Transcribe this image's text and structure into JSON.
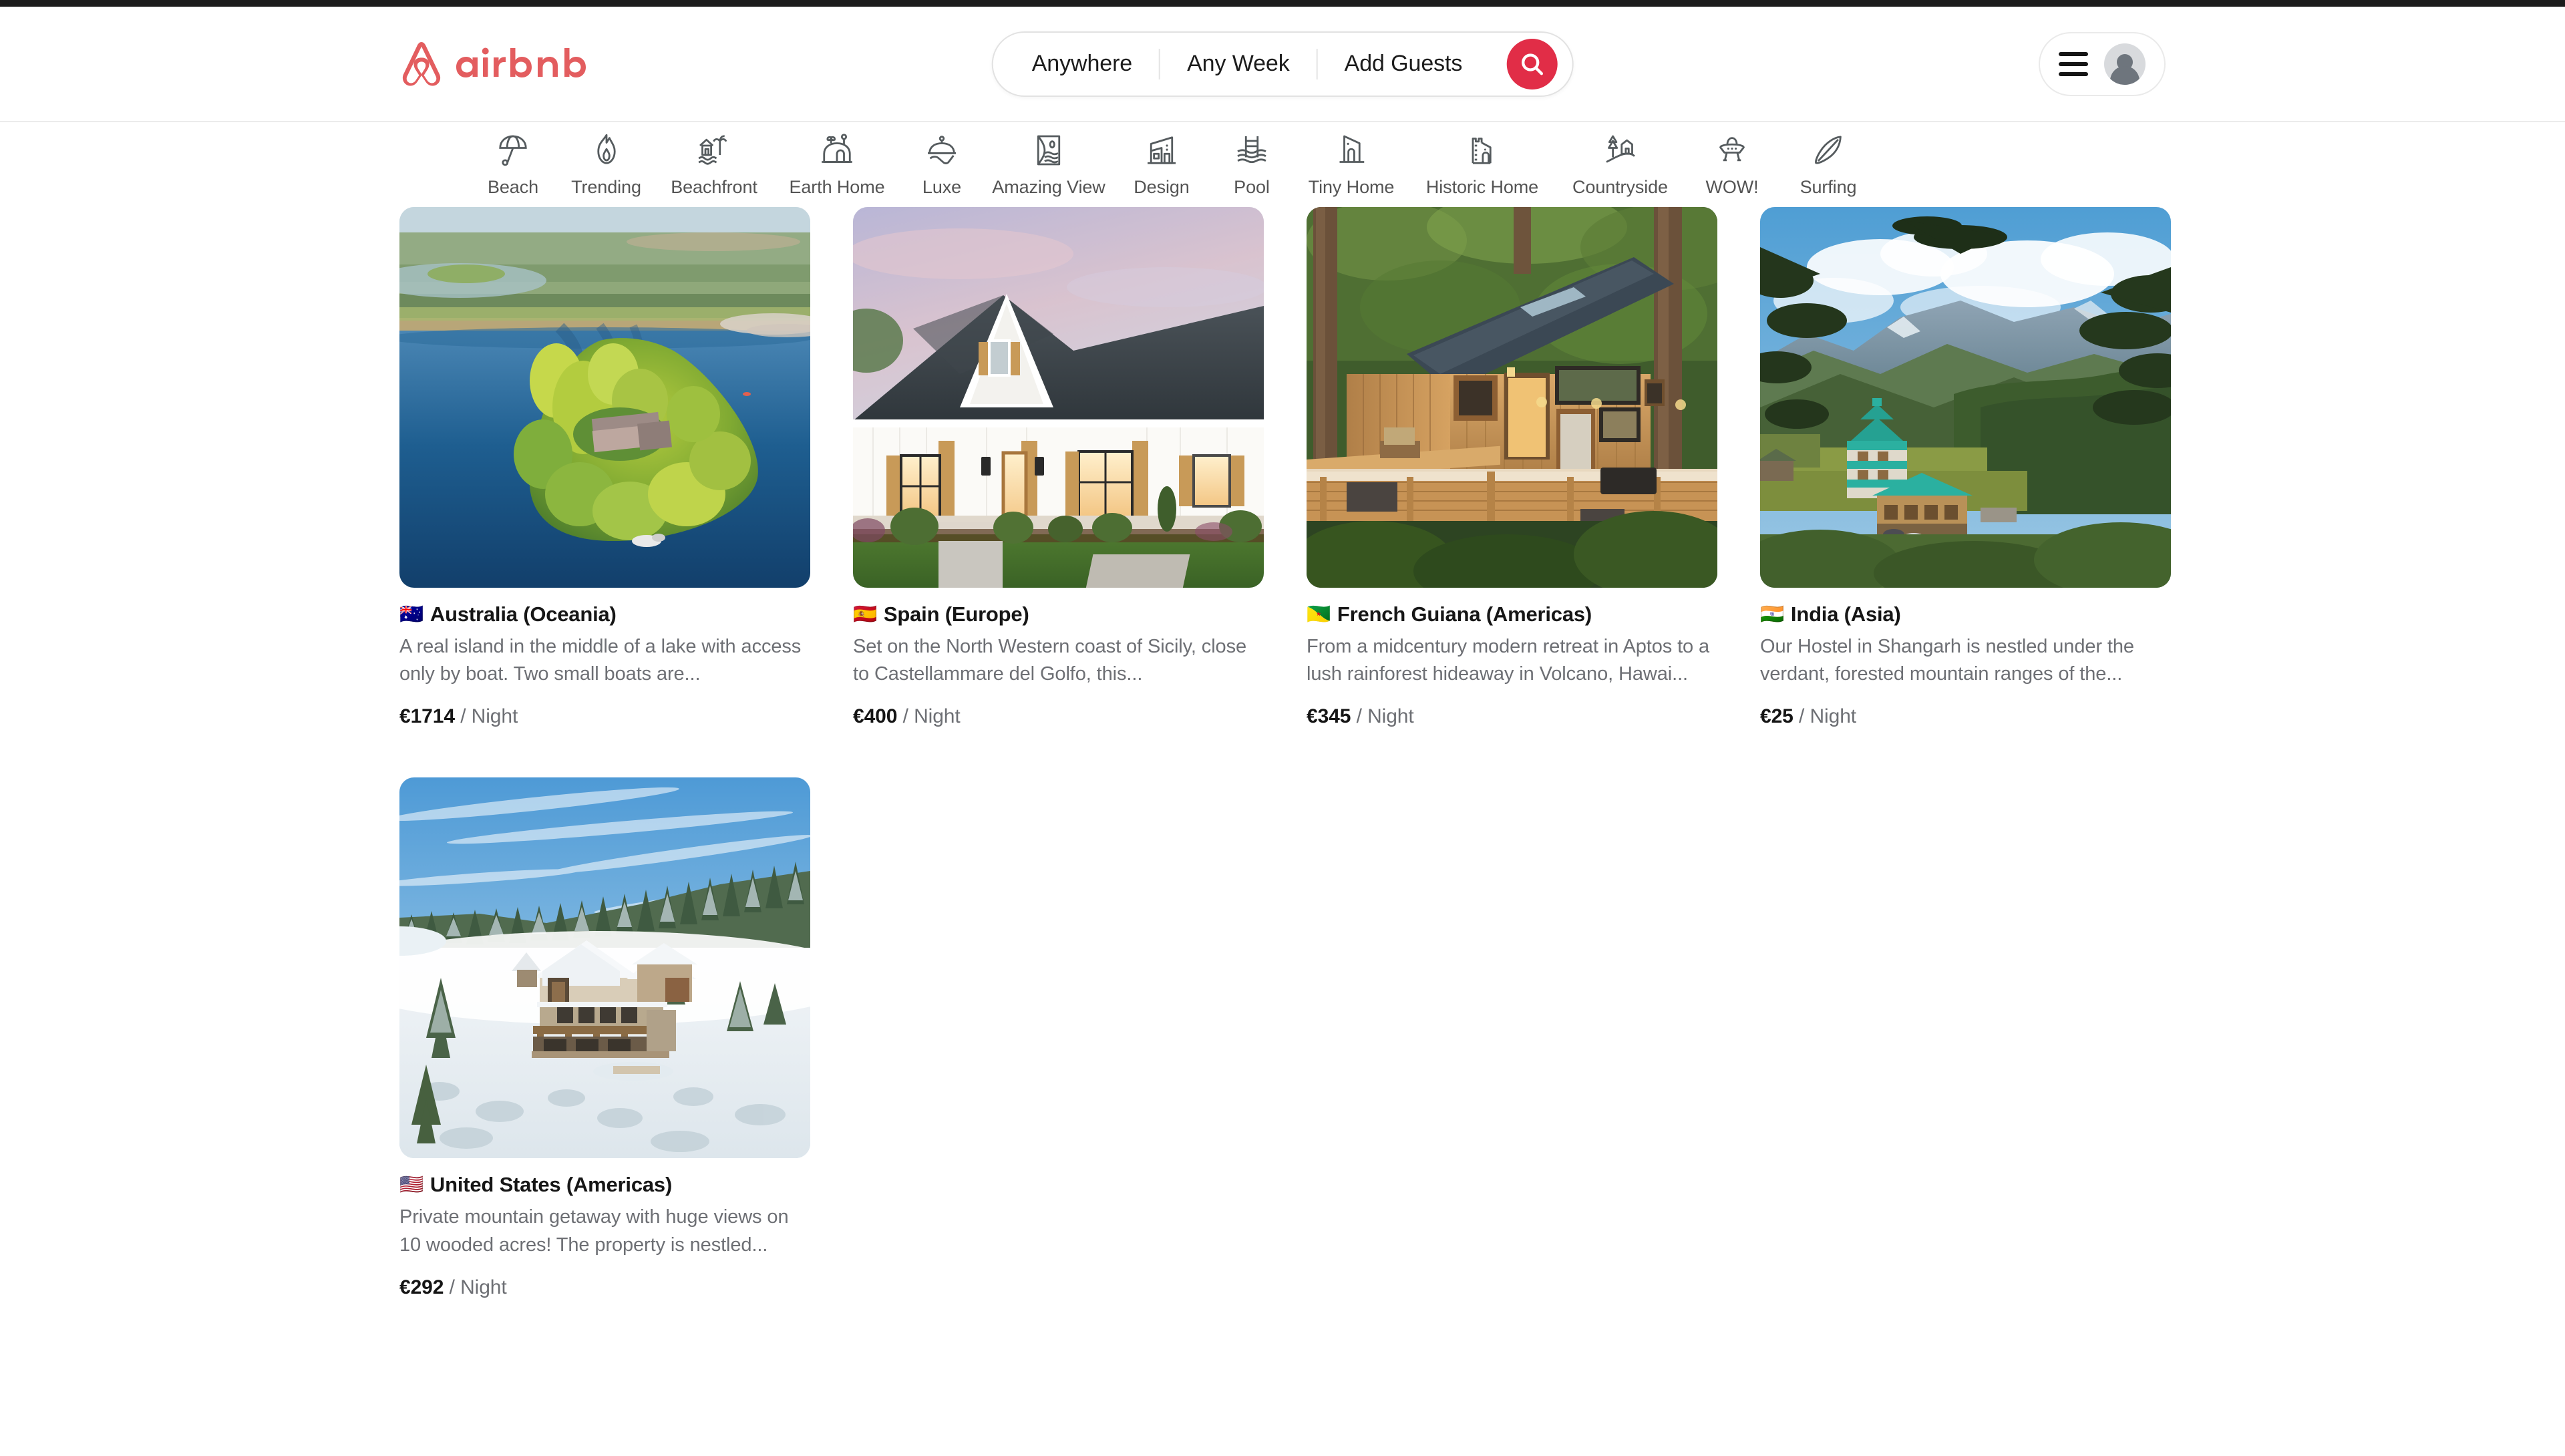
{
  "brand": {
    "name": "airbnb",
    "accent_color": "#e35d5f",
    "search_button_color": "#e12d47"
  },
  "header": {
    "search": {
      "location_label": "Anywhere",
      "dates_label": "Any Week",
      "guests_label": "Add Guests",
      "search_icon": "search-icon"
    },
    "user_menu": {
      "menu_icon": "hamburger-menu-icon",
      "avatar_icon": "user-avatar-icon"
    }
  },
  "categories": [
    {
      "label": "Beach",
      "icon": "beach-umbrella-icon"
    },
    {
      "label": "Trending",
      "icon": "flame-icon"
    },
    {
      "label": "Beachfront",
      "icon": "beachfront-hut-icon"
    },
    {
      "label": "Earth Home",
      "icon": "earth-home-icon"
    },
    {
      "label": "Luxe",
      "icon": "luxe-cloche-icon"
    },
    {
      "label": "Amazing View",
      "icon": "amazing-view-icon"
    },
    {
      "label": "Design",
      "icon": "design-building-icon"
    },
    {
      "label": "Pool",
      "icon": "pool-ladder-icon"
    },
    {
      "label": "Tiny Home",
      "icon": "tiny-home-icon"
    },
    {
      "label": "Historic Home",
      "icon": "castle-icon"
    },
    {
      "label": "Countryside",
      "icon": "countryside-icon"
    },
    {
      "label": "WOW!",
      "icon": "ufo-icon"
    },
    {
      "label": "Surfing",
      "icon": "surfboard-icon"
    }
  ],
  "listings": [
    {
      "flag": "🇦🇺",
      "title": "Australia (Oceania)",
      "description": "A real island in the middle of a lake with access only by boat. Two small boats are...",
      "price": "€1714",
      "price_unit": "/ Night",
      "image_alt": "aerial-view-island-on-lake"
    },
    {
      "flag": "🇪🇸",
      "title": "Spain (Europe)",
      "description": "Set on the North Western coast of Sicily, close to Castellammare del Golfo, this...",
      "price": "€400",
      "price_unit": "/ Night",
      "image_alt": "white-modern-farmhouse-at-dusk"
    },
    {
      "flag": "🇬🇫",
      "title": "French Guiana (Americas)",
      "description": "From a midcentury modern retreat in Aptos to a lush rainforest hideaway in Volcano, Hawai...",
      "price": "€345",
      "price_unit": "/ Night",
      "image_alt": "wooden-cabin-deck-in-forest"
    },
    {
      "flag": "🇮🇳",
      "title": "India (Asia)",
      "description": "Our Hostel in Shangarh is nestled under the verdant, forested mountain ranges of the...",
      "price": "€25",
      "price_unit": "/ Night",
      "image_alt": "himalayan-hostel-teal-roof-mountains"
    },
    {
      "flag": "🇺🇸",
      "title": "United States (Americas)",
      "description": "Private mountain getaway with huge views on 10 wooded acres! The property is nestled...",
      "price": "€292",
      "price_unit": "/ Night",
      "image_alt": "snowy-mountain-cabin-pine-forest"
    }
  ]
}
